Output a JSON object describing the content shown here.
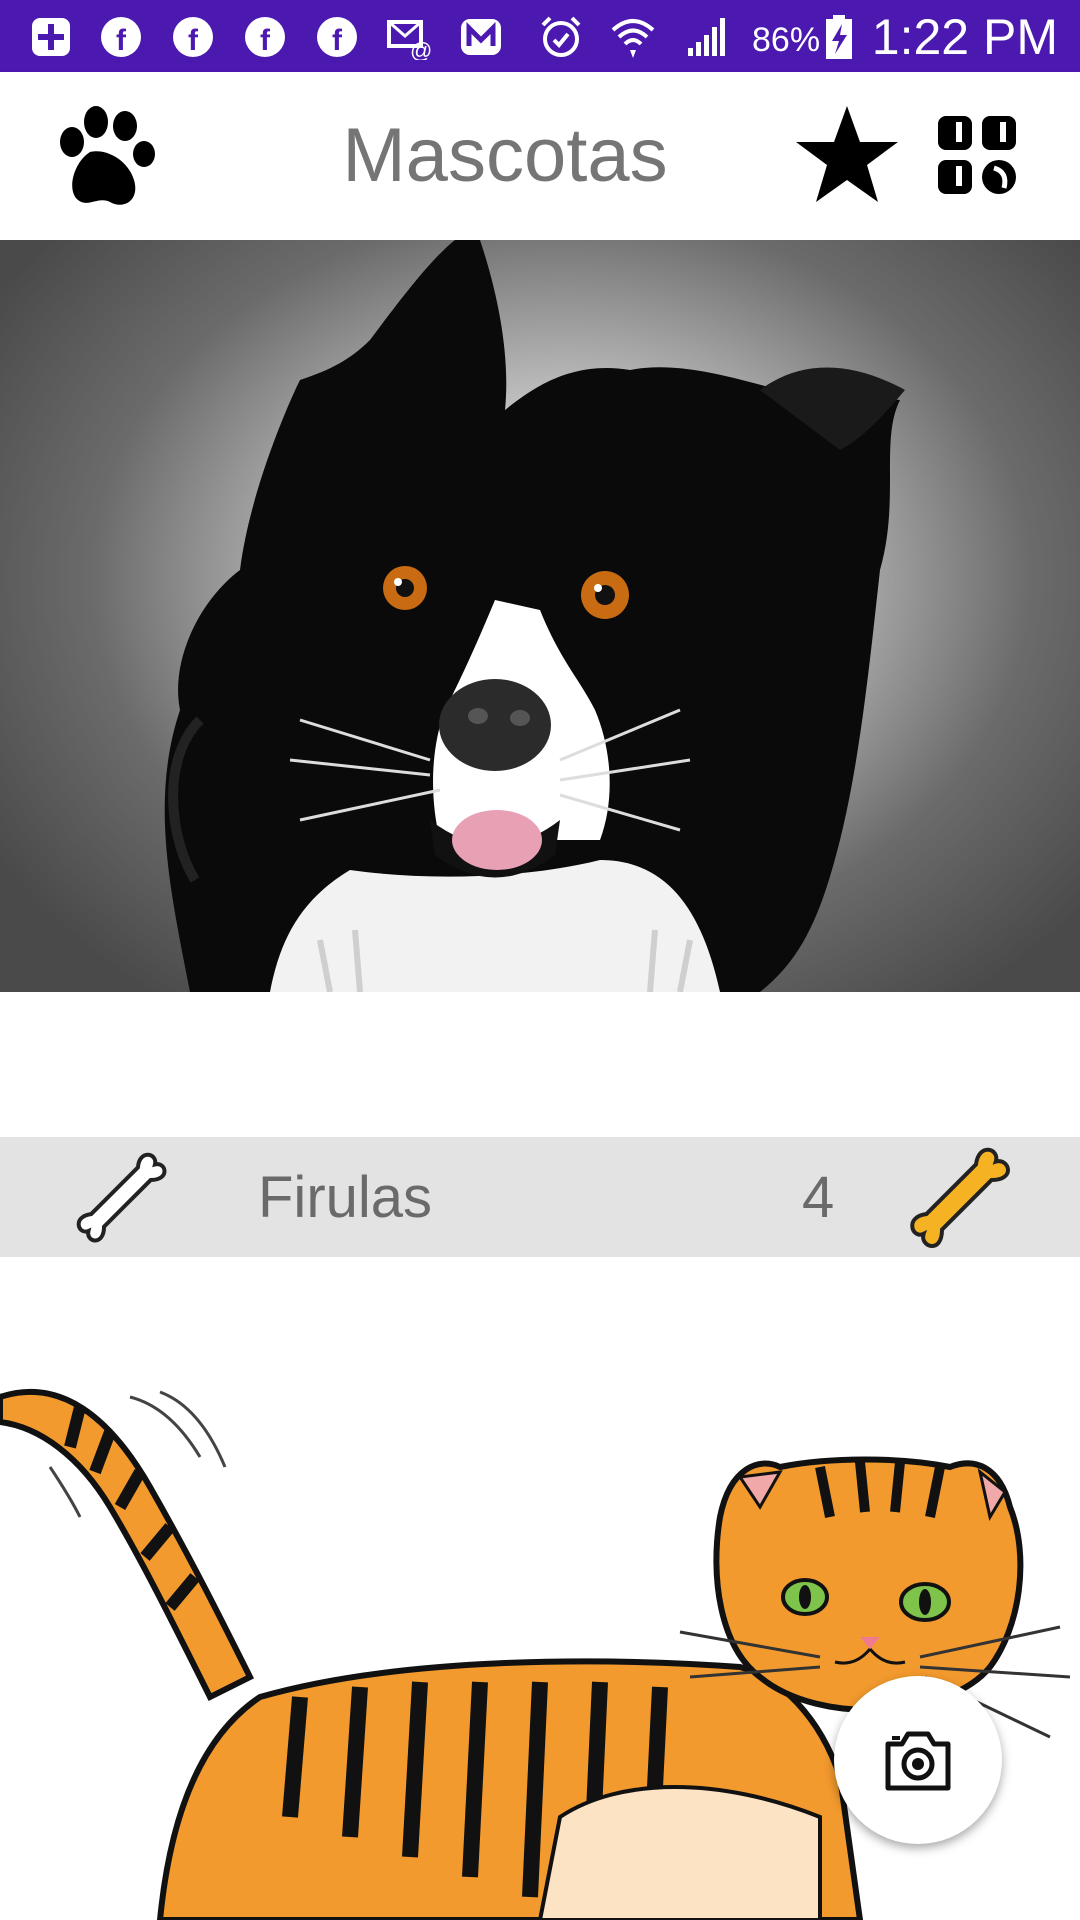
{
  "status_bar": {
    "notification_icons": [
      "plus-square-icon",
      "facebook-icon",
      "facebook-icon",
      "facebook-icon",
      "facebook-icon",
      "email-icon",
      "mail-app-icon",
      "alarm-icon",
      "wifi-icon",
      "signal-icon"
    ],
    "battery_percent": "86%",
    "time": "1:22 PM"
  },
  "app_bar": {
    "title": "Mascotas",
    "left_icon": "paw-icon",
    "actions": [
      "star-icon",
      "grid-icon"
    ]
  },
  "pets": [
    {
      "name": "Firulas",
      "rating": "4",
      "image": "dog-illustration"
    },
    {
      "image": "cat-illustration"
    }
  ],
  "fab": {
    "icon": "camera-icon"
  },
  "colors": {
    "status_bar": "#4b18b0",
    "bone_active": "#f5b324",
    "strip": "#e3e3e3",
    "text_gray": "#6a6a6a"
  }
}
